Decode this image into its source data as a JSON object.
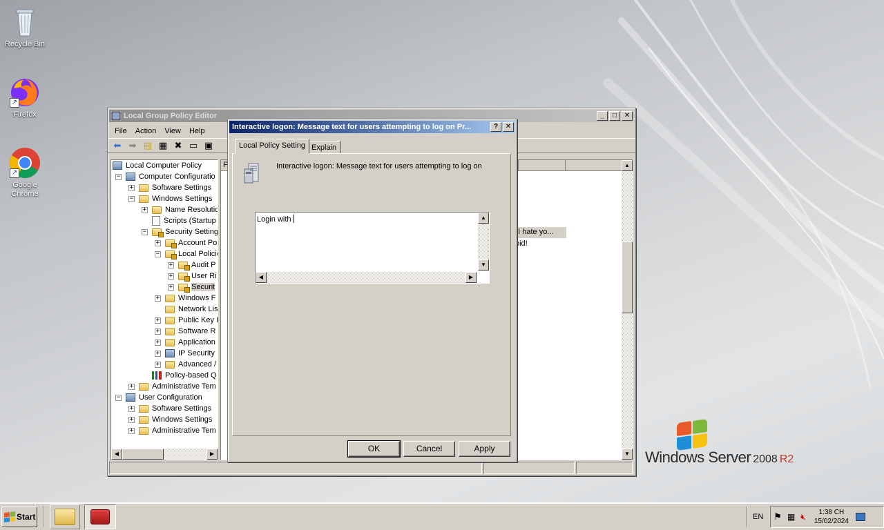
{
  "desktop": {
    "icons": [
      {
        "label": "Recycle Bin",
        "icon": "recycle-bin-icon"
      },
      {
        "label": "Firefox",
        "icon": "firefox-icon"
      },
      {
        "label": "Google Chrome",
        "icon": "chrome-icon"
      }
    ],
    "brand": {
      "text": "Windows Server",
      "version": "2008",
      "edition": "R2"
    }
  },
  "gpedit": {
    "title": "Local Group Policy Editor",
    "menu": [
      "File",
      "Action",
      "View",
      "Help"
    ],
    "tree": [
      {
        "label": "Local Computer Policy"
      },
      {
        "label": "Computer Configuratio"
      },
      {
        "label": "Software Settings"
      },
      {
        "label": "Windows Settings"
      },
      {
        "label": "Name Resolutio"
      },
      {
        "label": "Scripts (Startup"
      },
      {
        "label": "Security Setting"
      },
      {
        "label": "Account Po"
      },
      {
        "label": "Local Policie"
      },
      {
        "label": "Audit P"
      },
      {
        "label": "User Ri"
      },
      {
        "label": "Securit"
      },
      {
        "label": "Windows F"
      },
      {
        "label": "Network Lis"
      },
      {
        "label": "Public Key I"
      },
      {
        "label": "Software R"
      },
      {
        "label": "Application"
      },
      {
        "label": "IP Security"
      },
      {
        "label": "Advanced /"
      },
      {
        "label": "Policy-based Q"
      },
      {
        "label": "Administrative Tem"
      },
      {
        "label": "User Configuration"
      },
      {
        "label": "Software Settings"
      },
      {
        "label": "Windows Settings"
      },
      {
        "label": "Administrative Tem"
      }
    ],
    "right_pane": {
      "col_header_partial": "F",
      "col_header2": "",
      "cell_1": "! I hate yo...",
      "cell_2": "pid!"
    }
  },
  "dialog": {
    "title": "Interactive logon: Message text for users attempting to log on Pr...",
    "tabs": [
      "Local Policy Setting",
      "Explain"
    ],
    "description": "Interactive logon: Message text for users attempting to log on",
    "text_value": "Login with ",
    "buttons": {
      "ok": "OK",
      "cancel": "Cancel",
      "apply": "Apply"
    }
  },
  "taskbar": {
    "start_label": "Start",
    "language": "EN",
    "time": "1:38 CH",
    "date": "15/02/2024"
  }
}
